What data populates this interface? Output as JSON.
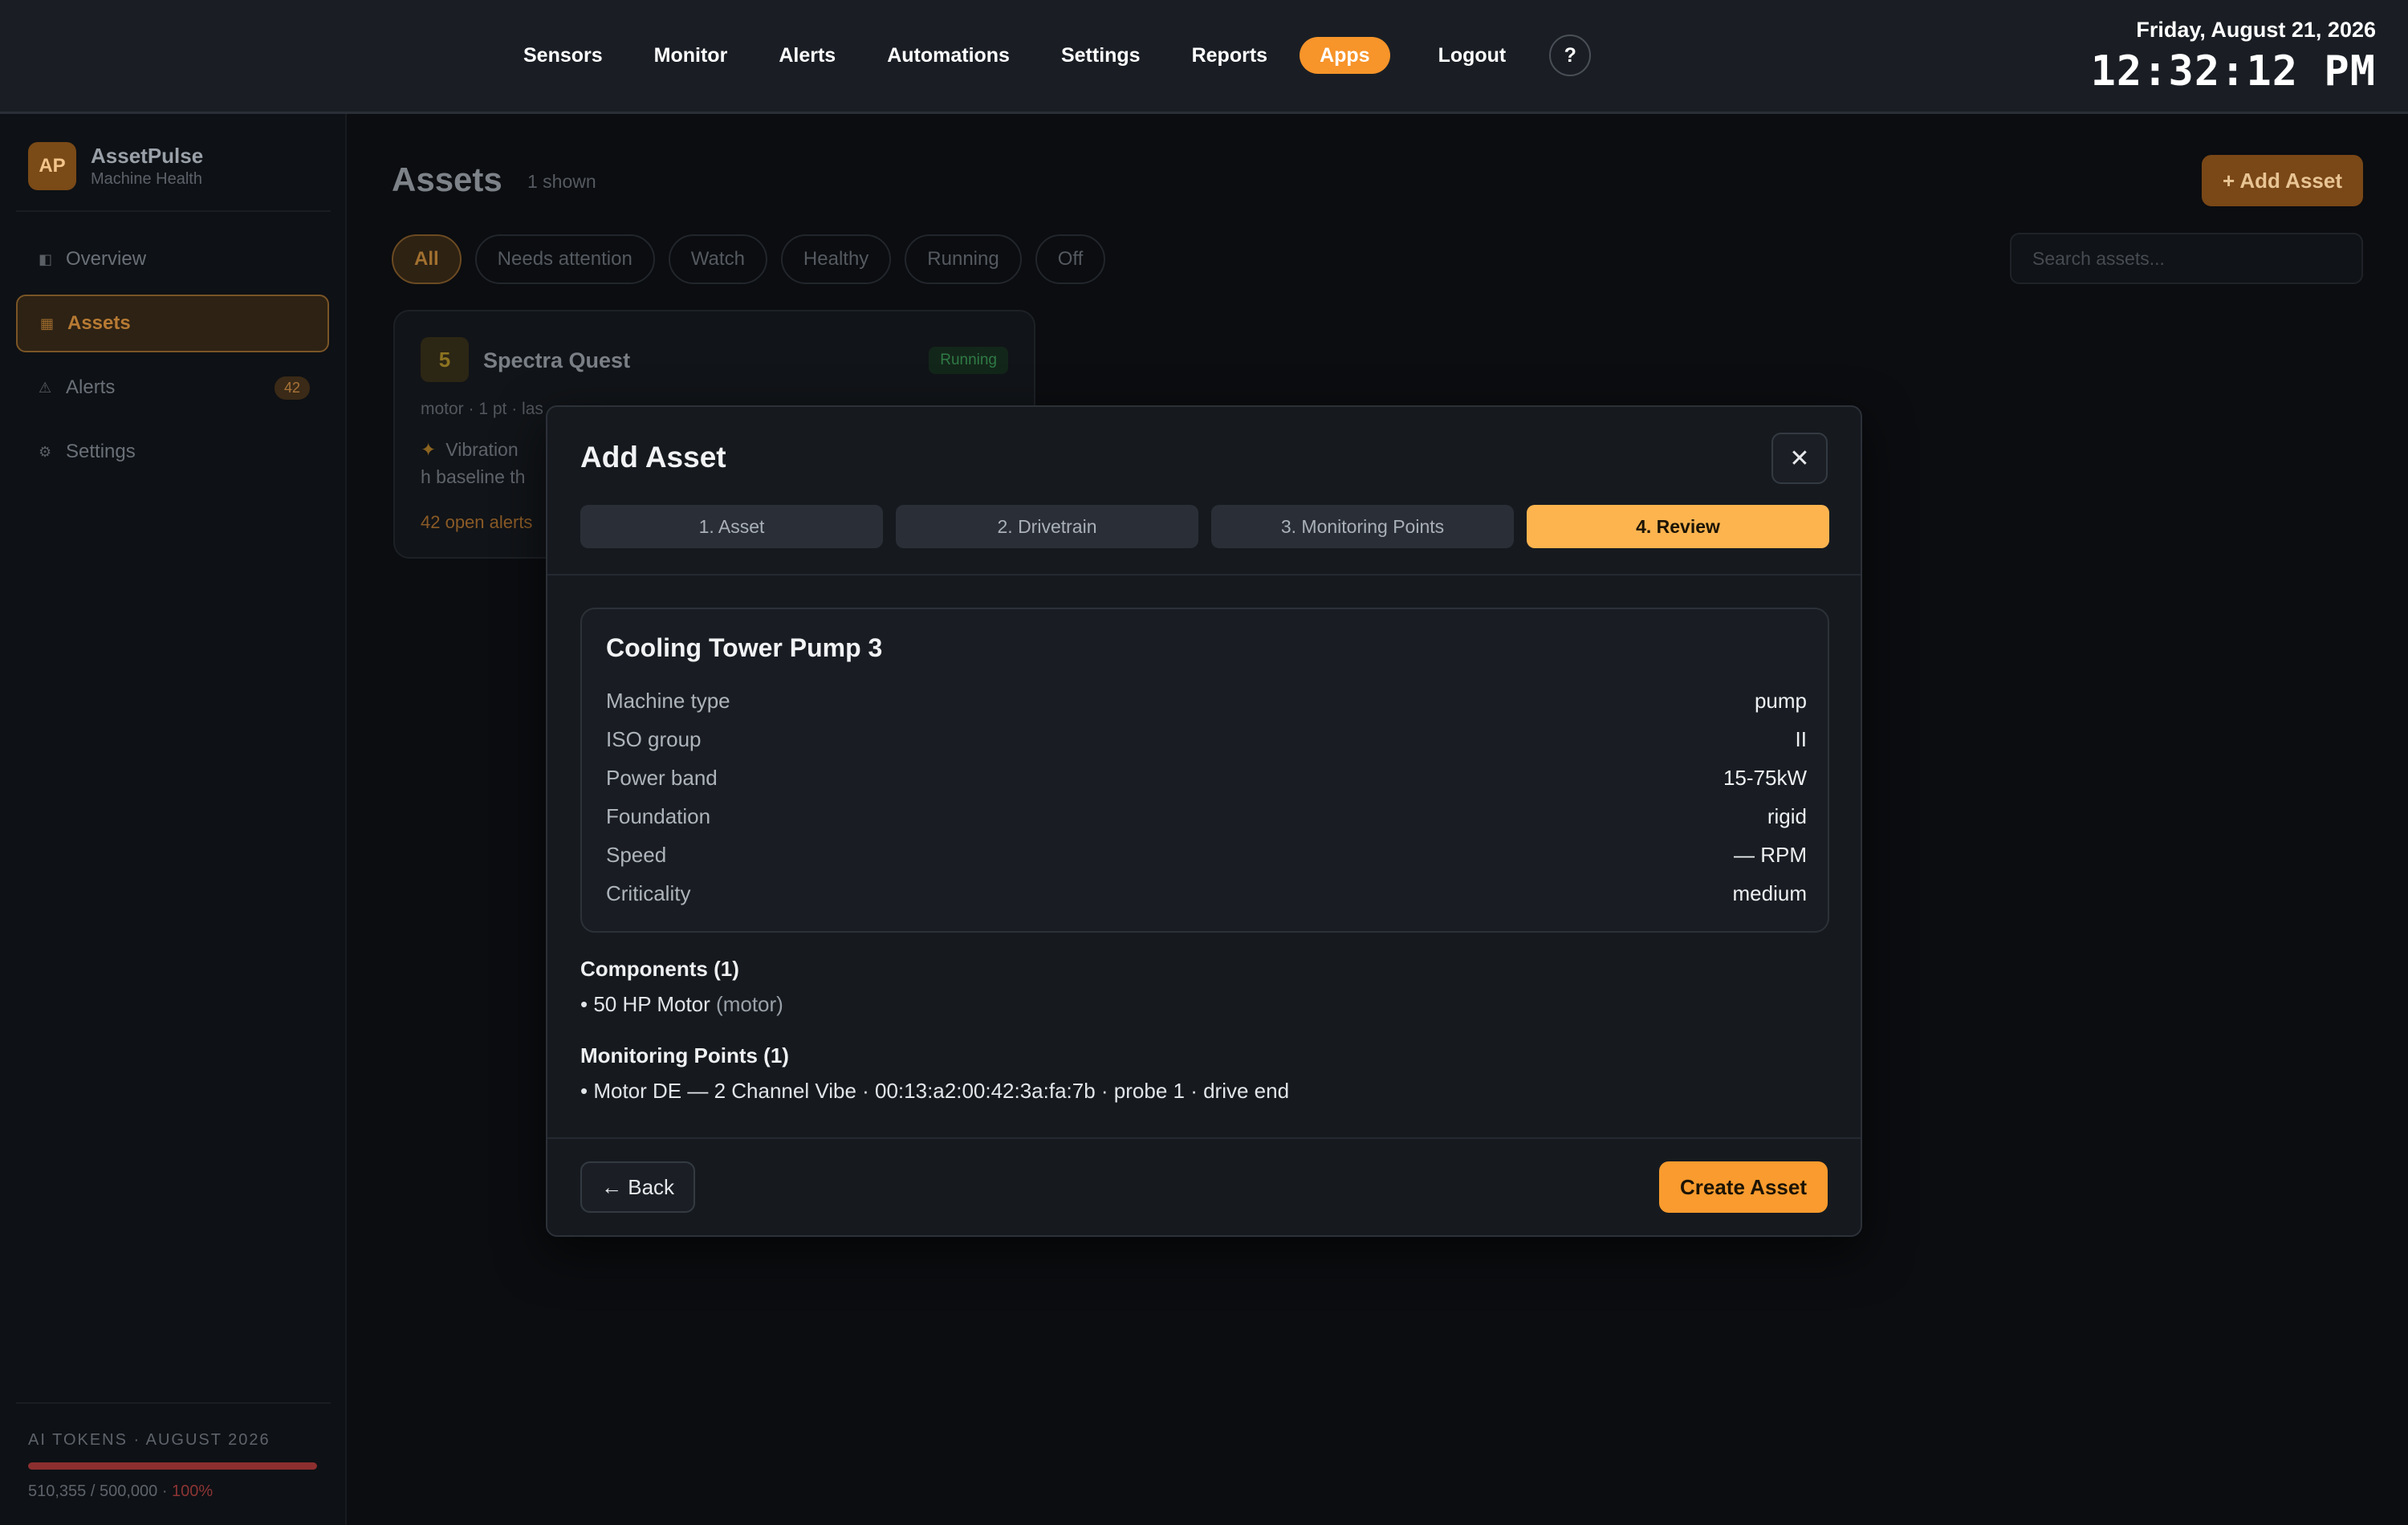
{
  "nav": {
    "items": [
      "Sensors",
      "Monitor",
      "Alerts",
      "Automations",
      "Settings",
      "Reports"
    ],
    "active": "Apps",
    "logout": "Logout",
    "help": "?"
  },
  "clock": {
    "date": "Friday, August 21, 2026",
    "time": "12:32:12 PM"
  },
  "brand": {
    "badge": "AP",
    "name": "AssetPulse",
    "subtitle": "Machine Health"
  },
  "sidebar": {
    "items": [
      {
        "label": "Overview",
        "icon": "overview-icon",
        "glyph": "◧"
      },
      {
        "label": "Assets",
        "icon": "assets-icon",
        "glyph": "▦"
      },
      {
        "label": "Alerts",
        "icon": "alert-triangle-icon",
        "glyph": "⚠",
        "badge": "42"
      },
      {
        "label": "Settings",
        "icon": "gear-icon",
        "glyph": "⚙"
      }
    ],
    "tokens": {
      "label": "AI TOKENS · AUGUST 2026",
      "value": "510,355 / 500,000 ·",
      "percent": "100%",
      "fill_fraction": 1.0
    }
  },
  "main": {
    "title": "Assets",
    "count": "1 shown",
    "add_button": "+ Add Asset",
    "filters": [
      "All",
      "Needs attention",
      "Watch",
      "Healthy",
      "Running",
      "Off"
    ],
    "search_placeholder": "Search assets...",
    "card": {
      "number": "5",
      "name": "Spectra Quest",
      "status": "Running",
      "meta": "motor · 1 pt · las",
      "alert_glyph": "✦",
      "alert_text": "Vibration h baseline th",
      "open_alerts": "42 open alerts"
    }
  },
  "modal": {
    "title": "Add Asset",
    "close": "✕",
    "steps": [
      "1. Asset",
      "2. Drivetrain",
      "3. Monitoring Points",
      "4. Review"
    ],
    "active_step": 3,
    "asset_name": "Cooling Tower Pump 3",
    "specs": [
      {
        "label": "Machine type",
        "value": "pump"
      },
      {
        "label": "ISO group",
        "value": "II"
      },
      {
        "label": "Power band",
        "value": "15-75kW"
      },
      {
        "label": "Foundation",
        "value": "rigid"
      },
      {
        "label": "Speed",
        "value": "— RPM"
      },
      {
        "label": "Criticality",
        "value": "medium"
      }
    ],
    "components_heading": "Components (1)",
    "component": {
      "name": "• 50 HP Motor",
      "type": "(motor)"
    },
    "points_heading": "Monitoring Points (1)",
    "point": "• Motor DE — 2 Channel Vibe · 00:13:a2:00:42:3a:fa:7b · probe 1 · drive end",
    "back": "← Back",
    "create": "Create Asset"
  },
  "colors": {
    "accent": "#f99b2e",
    "step_active": "#fdb44f",
    "danger": "#8d2f2f"
  }
}
